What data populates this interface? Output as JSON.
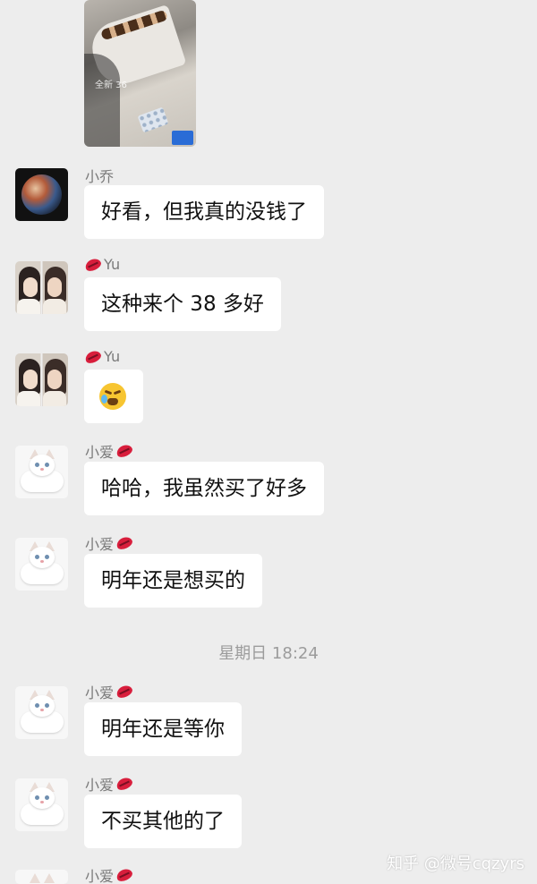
{
  "chat": {
    "photo": {
      "caption": "全新 36"
    },
    "messages": [
      {
        "sender": "小乔",
        "text": "好看，但我真的没钱了",
        "avatar": "planet-avatar"
      },
      {
        "sender": "Yu",
        "text": "这种来个 38 多好",
        "avatar": "girls-avatar",
        "badge": "lips-icon"
      },
      {
        "sender": "Yu",
        "text": "",
        "emoji": "crying-laughing-emoji",
        "avatar": "girls-avatar",
        "badge": "lips-icon"
      },
      {
        "sender": "小爱",
        "text": "哈哈，我虽然买了好多",
        "avatar": "cat-avatar",
        "badge": "lips-icon"
      },
      {
        "sender": "小爱",
        "text": "明年还是想买的",
        "avatar": "cat-avatar",
        "badge": "lips-icon"
      },
      {
        "sender": "小爱",
        "text": "明年还是等你",
        "avatar": "cat-avatar",
        "badge": "lips-icon"
      },
      {
        "sender": "小爱",
        "text": "不买其他的了",
        "avatar": "cat-avatar",
        "badge": "lips-icon"
      },
      {
        "sender": "小爱",
        "text": "",
        "avatar": "cat-avatar",
        "badge": "lips-icon"
      }
    ],
    "timestamp": "星期日 18:24"
  },
  "watermark": "知乎 @微号cqzyrs",
  "colors": {
    "background": "#ededed",
    "bubble": "#ffffff",
    "badge": "#d81e3c"
  }
}
